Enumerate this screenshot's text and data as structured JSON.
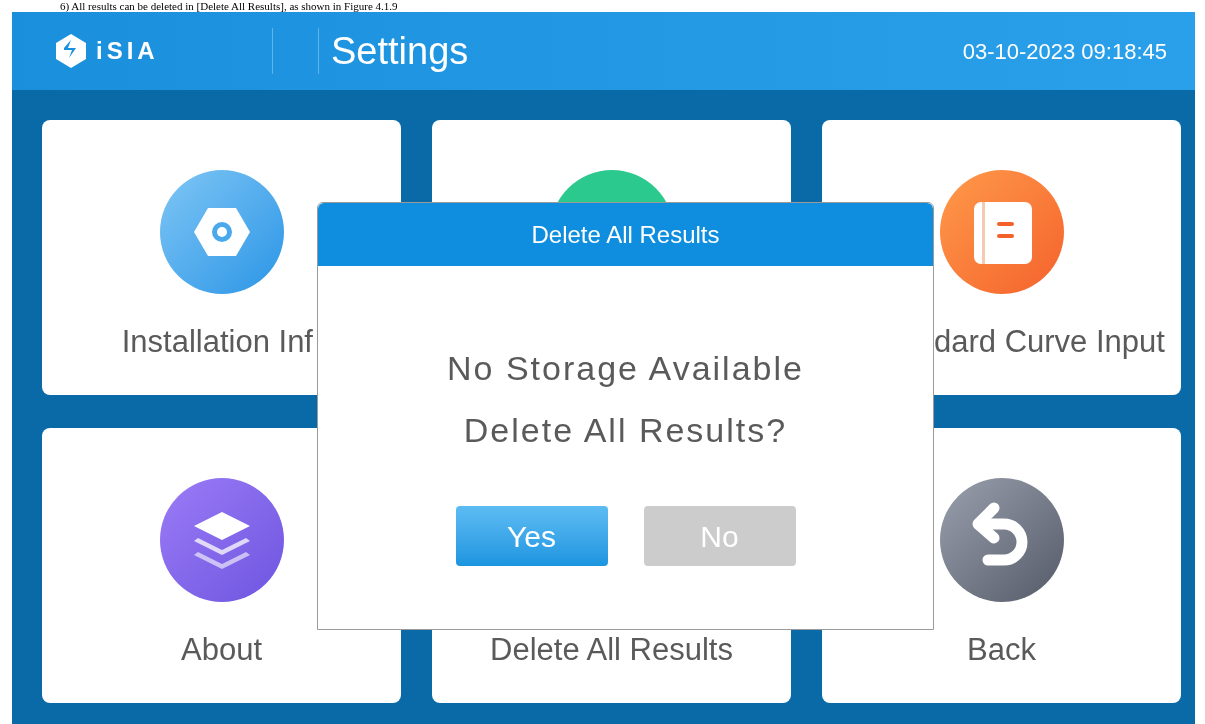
{
  "document_text": "6) All results can be deleted in [Delete All Results], as shown in Figure 4.1.9",
  "header": {
    "logo": "iSIA",
    "title": "Settings",
    "datetime": "03-10-2023 09:18:45"
  },
  "tiles": [
    {
      "label": "Installation Inf",
      "kind": "nut"
    },
    {
      "kind": "circle"
    },
    {
      "label": "dard Curve Input",
      "kind": "book"
    },
    {
      "label": "About",
      "kind": "layers"
    },
    {
      "label": "Delete All Results"
    },
    {
      "label": "Back",
      "kind": "back"
    }
  ],
  "dialog": {
    "title": "Delete All Results",
    "message": [
      "No Storage Available",
      "Delete All Results?"
    ],
    "buttons": [
      {
        "label": "Yes",
        "kind": "primary"
      },
      {
        "label": "No",
        "kind": "secondary"
      }
    ]
  }
}
